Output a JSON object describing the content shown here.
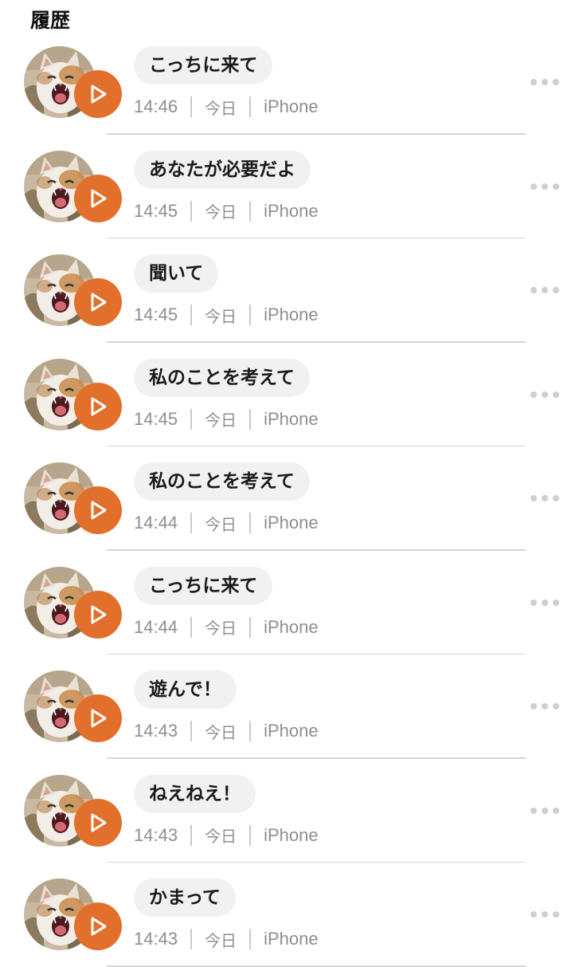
{
  "header": {
    "title": "履歴"
  },
  "colors": {
    "accent": "#e2702c",
    "bubble": "#f1f1f1",
    "meta_text": "#8e8e8e"
  },
  "icons": {
    "avatar": "cat-photo",
    "play": "play-icon",
    "more": "more-dots-icon"
  },
  "history": [
    {
      "message": "こっちに来て",
      "time": "14:46",
      "day": "今日",
      "device": "iPhone"
    },
    {
      "message": "あなたが必要だよ",
      "time": "14:45",
      "day": "今日",
      "device": "iPhone"
    },
    {
      "message": "聞いて",
      "time": "14:45",
      "day": "今日",
      "device": "iPhone"
    },
    {
      "message": "私のことを考えて",
      "time": "14:45",
      "day": "今日",
      "device": "iPhone"
    },
    {
      "message": "私のことを考えて",
      "time": "14:44",
      "day": "今日",
      "device": "iPhone"
    },
    {
      "message": "こっちに来て",
      "time": "14:44",
      "day": "今日",
      "device": "iPhone"
    },
    {
      "message": "遊んで！",
      "time": "14:43",
      "day": "今日",
      "device": "iPhone"
    },
    {
      "message": "ねえねえ！",
      "time": "14:43",
      "day": "今日",
      "device": "iPhone"
    },
    {
      "message": "かまって",
      "time": "14:43",
      "day": "今日",
      "device": "iPhone"
    }
  ]
}
